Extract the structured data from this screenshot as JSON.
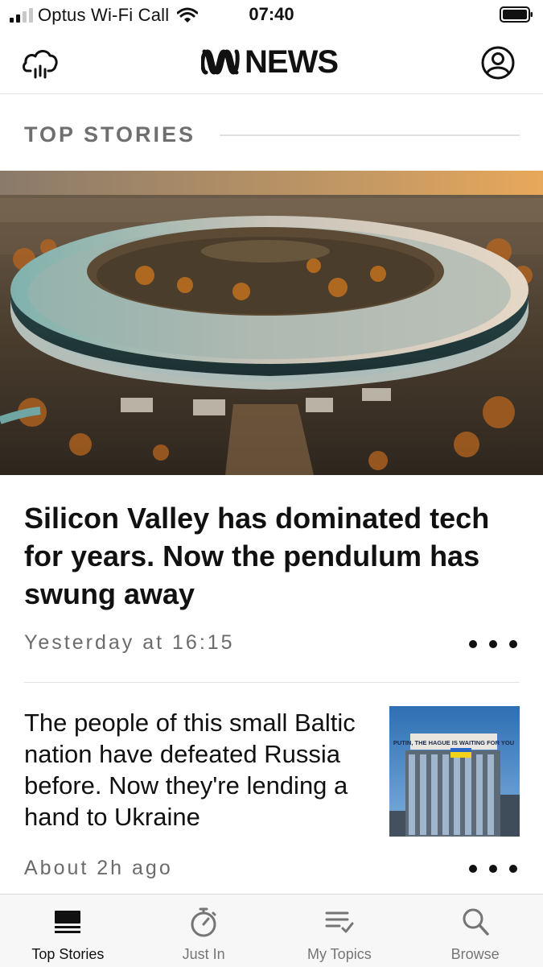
{
  "status_bar": {
    "carrier": "Optus Wi-Fi Call",
    "time": "07:40",
    "signal_bars": 4,
    "signal_bars_active": 2,
    "icons": [
      "signal-icon",
      "wifi-icon",
      "battery-icon"
    ]
  },
  "header": {
    "logo_text": "NEWS",
    "left_icon": "weather-cloud-icon",
    "right_icon": "profile-icon"
  },
  "section": {
    "heading": "TOP STORIES"
  },
  "stories": [
    {
      "title": "Silicon Valley has dominated tech for years. Now the pendulum has swung away",
      "timestamp": "Yesterday at 16:15",
      "image": "hero-image-ring-campus"
    },
    {
      "title": "The people of this small Baltic nation have defeated Russia before. Now they're lending a hand to Ukraine",
      "timestamp": "About 2h ago",
      "image": "thumbnail-building"
    }
  ],
  "thumbnail_sign_text": "PUTIN, THE HAGUE IS WAITING FOR YOU",
  "tabs": [
    {
      "label": "Top Stories",
      "icon": "top-stories-icon",
      "active": true
    },
    {
      "label": "Just In",
      "icon": "stopwatch-icon",
      "active": false
    },
    {
      "label": "My Topics",
      "icon": "my-topics-icon",
      "active": false
    },
    {
      "label": "Browse",
      "icon": "search-icon",
      "active": false
    }
  ],
  "colors": {
    "text": "#111111",
    "meta": "#6b6b6b",
    "section_heading": "#6f6f6f",
    "tab_inactive": "#757575",
    "tab_bar_bg": "#f7f7f7"
  }
}
